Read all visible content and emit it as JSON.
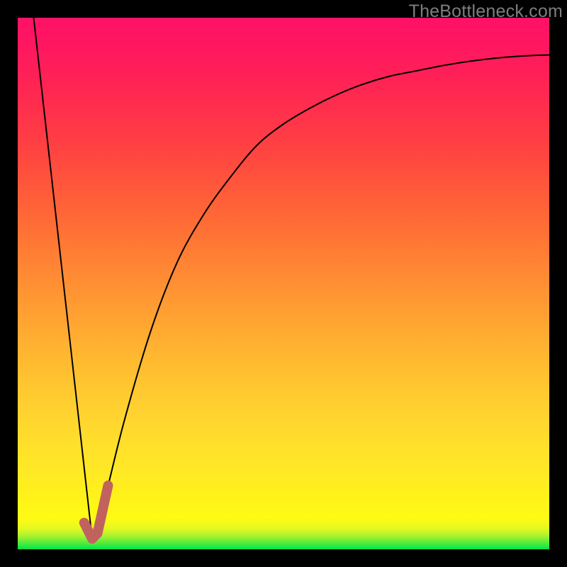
{
  "watermark": "TheBottleneck.com",
  "chart_data": {
    "type": "line",
    "title": "",
    "xlabel": "",
    "ylabel": "",
    "xlim": [
      0,
      100
    ],
    "ylim": [
      0,
      100
    ],
    "grid": false,
    "series": [
      {
        "name": "black-curve",
        "color": "#000000",
        "x": [
          3,
          14,
          16,
          20,
          25,
          30,
          35,
          40,
          45,
          50,
          55,
          60,
          65,
          70,
          75,
          80,
          85,
          90,
          95,
          100
        ],
        "y": [
          100,
          2,
          8,
          24,
          41,
          54,
          63,
          70,
          76,
          80,
          83,
          85.5,
          87.5,
          89,
          90,
          91,
          91.8,
          92.4,
          92.8,
          93
        ]
      },
      {
        "name": "highlight-segment",
        "color": "#c1625f",
        "x": [
          12.5,
          14,
          15,
          17
        ],
        "y": [
          5,
          2,
          3,
          12
        ]
      }
    ]
  }
}
